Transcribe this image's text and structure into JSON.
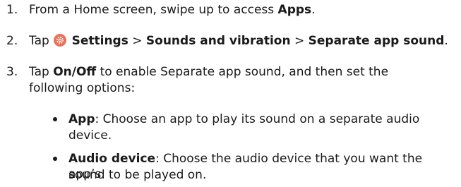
{
  "steps": [
    {
      "number": "1.",
      "before": "From a Home screen, swipe up to access ",
      "bold": "Apps",
      "after": "."
    },
    {
      "number": "2.",
      "tap": "Tap",
      "icon": "settings-gear-icon",
      "settings": "Settings",
      "sep1": ">",
      "sounds": "Sounds and vibration",
      "sep2": ">",
      "separate": "Separate app sound",
      "end": "."
    },
    {
      "number": "3.",
      "tap": "Tap ",
      "onoff": "On/Off",
      "line1": " to enable Separate app sound, and then set the",
      "line2": "following options:"
    }
  ],
  "bullets": [
    {
      "label": "App",
      "line1": ": Choose an app to play its sound on a separate audio",
      "line2": "device."
    },
    {
      "label": "Audio device",
      "line1": ": Choose the audio device that you want the app’s",
      "line2": "sound to be played on."
    }
  ],
  "colors": {
    "text": "#1a1a1a",
    "icon_bg": "#e8725a"
  }
}
